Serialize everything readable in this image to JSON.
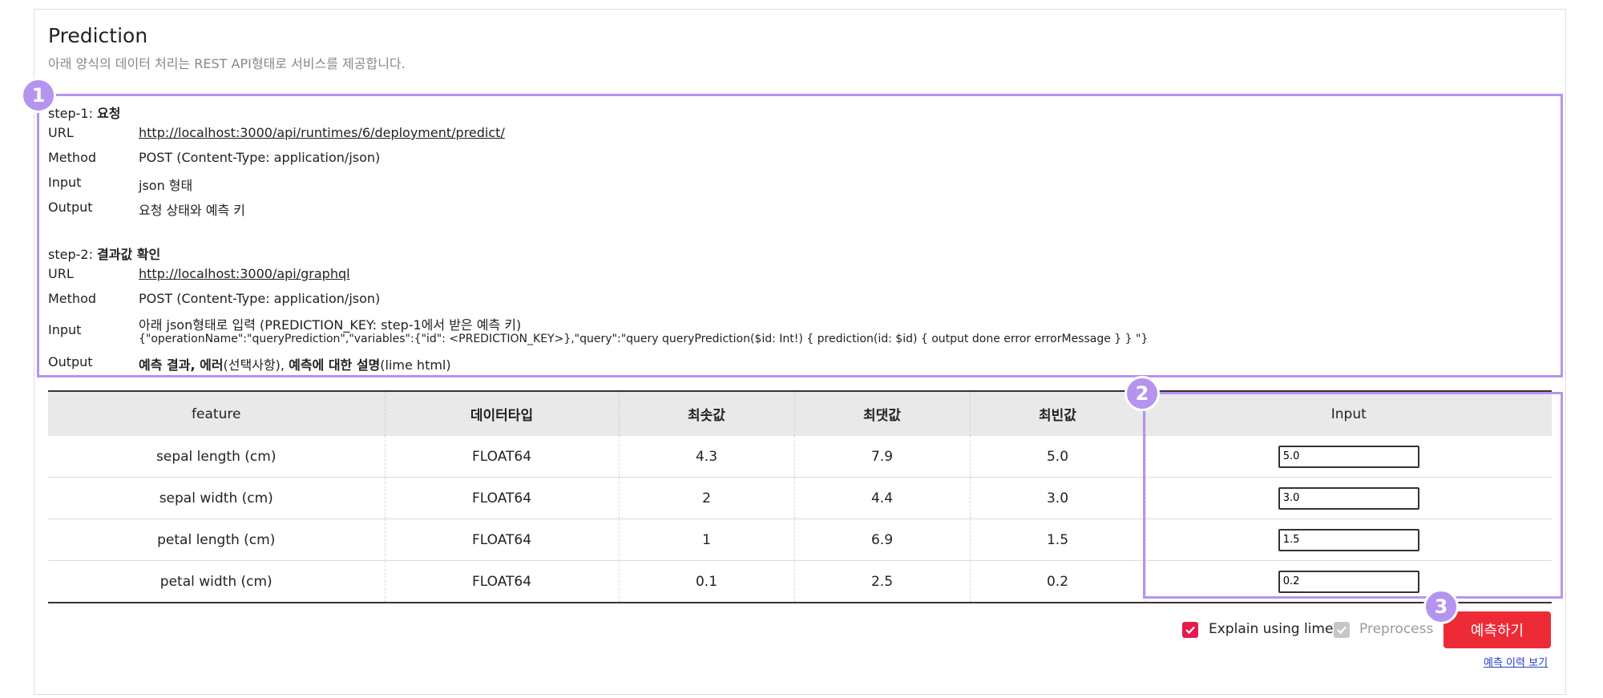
{
  "header": {
    "title": "Prediction",
    "subtitle": "아래 양식의 데이터 처리는 REST API형태로 서비스를 제공합니다."
  },
  "step1": {
    "prefix": "step-1: ",
    "title": "요청",
    "rows": [
      {
        "label": "URL",
        "value": "http://localhost:3000/api/runtimes/6/deployment/predict/"
      },
      {
        "label": "Method",
        "value": "POST (Content-Type: application/json)"
      },
      {
        "label": "Input",
        "value": "json 형태"
      },
      {
        "label": "Output",
        "value": "요청 상태와 예측 키"
      }
    ]
  },
  "step2": {
    "prefix": "step-2: ",
    "title": "결과값 확인",
    "url_label": "URL",
    "url": "http://localhost:3000/api/graphql",
    "method_label": "Method",
    "method": "POST (Content-Type: application/json)",
    "input_label": "Input",
    "input_line1": "아래 json형태로 입력 (PREDICTION_KEY: step-1에서 받은 예측 키)",
    "input_line2": "{\"operationName\":\"queryPrediction\",\"variables\":{\"id\": <PREDICTION_KEY>},\"query\":\"query queryPrediction($id: Int!) { prediction(id: $id) { output done error errorMessage } } \"}",
    "output_label": "Output",
    "output_b1": "예측 결과, 에러",
    "output_t1": "(선택사항), ",
    "output_b2": "예측에 대한 설명",
    "output_t2": "(lime html)"
  },
  "table": {
    "headers": [
      "feature",
      "데이터타입",
      "최솟값",
      "최댓값",
      "최빈값",
      "Input"
    ],
    "rows": [
      {
        "feature": "sepal length (cm)",
        "type": "FLOAT64",
        "min": "4.3",
        "max": "7.9",
        "mode": "5.0",
        "input": "5.0"
      },
      {
        "feature": "sepal width (cm)",
        "type": "FLOAT64",
        "min": "2",
        "max": "4.4",
        "mode": "3.0",
        "input": "3.0"
      },
      {
        "feature": "petal length (cm)",
        "type": "FLOAT64",
        "min": "1",
        "max": "6.9",
        "mode": "1.5",
        "input": "1.5"
      },
      {
        "feature": "petal width (cm)",
        "type": "FLOAT64",
        "min": "0.1",
        "max": "2.5",
        "mode": "0.2",
        "input": "0.2"
      }
    ]
  },
  "options": {
    "explain_label": "Explain using lime",
    "explain_checked": true,
    "preprocess_label": "Preprocess",
    "preprocess_checked": true,
    "preprocess_disabled": true
  },
  "actions": {
    "predict_label": "예측하기",
    "history_label": "예측 이력 보기"
  },
  "badges": [
    "1",
    "2",
    "3"
  ],
  "colors": {
    "accent": "#ee2a36",
    "highlight": "#b594f0",
    "checkbox_checked": "#e8194b",
    "checkbox_disabled": "#c6c6c6"
  }
}
